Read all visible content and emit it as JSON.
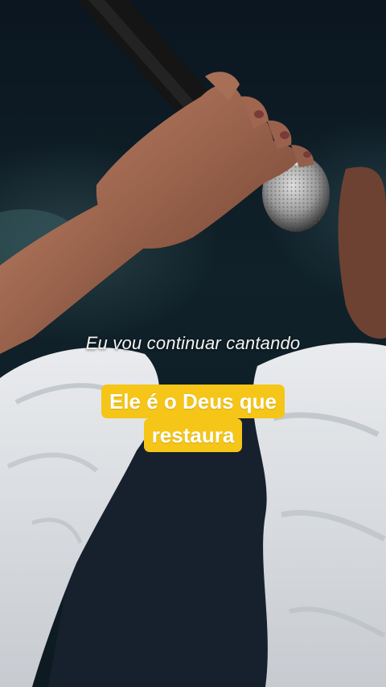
{
  "captions": {
    "subtitle": "Eu vou continuar cantando",
    "highlight_line1": "Ele é o Deus que",
    "highlight_line2": "restaura"
  },
  "colors": {
    "highlight_bg": "#f5c518",
    "subtitle_text": "#f4f4f4",
    "highlight_text": "#ffffff"
  }
}
